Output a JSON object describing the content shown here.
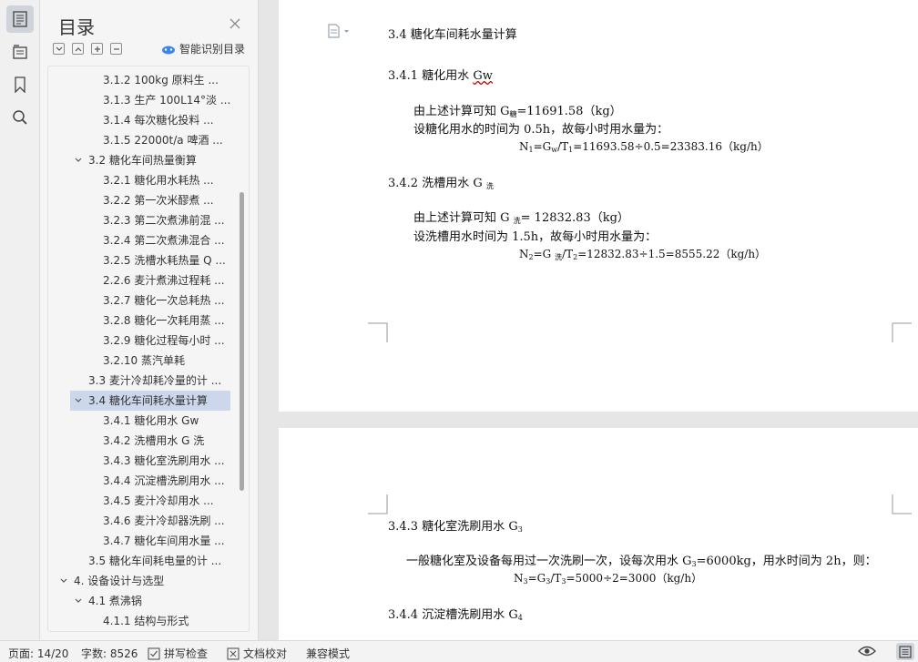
{
  "toc": {
    "title": "目录",
    "smart_label": "智能识别目录",
    "items": [
      {
        "label": "3.1.2   100kg 原料生 ..."
      },
      {
        "label": "3.1.3  生产 100L14°淡 ..."
      },
      {
        "label": "3.1.4   每次糖化投料 ..."
      },
      {
        "label": "3.1.5   22000t/a 啤酒 ..."
      },
      {
        "label": "3.2   糖化车间热量衡算"
      },
      {
        "label": "3.2.1   糖化用水耗热 ..."
      },
      {
        "label": "3.2.2   第一次米醪煮 ..."
      },
      {
        "label": "3.2.3  第二次煮沸前混 ..."
      },
      {
        "label": "3.2.4  第二次煮沸混合 ..."
      },
      {
        "label": "3.2.5  洗槽水耗热量 Q ..."
      },
      {
        "label": "2.2.6 麦汁煮沸过程耗 ..."
      },
      {
        "label": "3.2.7  糖化一次总耗热 ..."
      },
      {
        "label": "3.2.8  糖化一次耗用蒸 ..."
      },
      {
        "label": "3.2.9  糖化过程每小时 ..."
      },
      {
        "label": "3.2.10  蒸汽单耗"
      },
      {
        "label": "3.3  麦汁冷却耗冷量的计 ..."
      },
      {
        "label": "3.4   糖化车间耗水量计算"
      },
      {
        "label": "3.4.1   糖化用水 Gw"
      },
      {
        "label": "3.4.2   洗槽用水 G 洗"
      },
      {
        "label": "3.4.3  糖化室洗刷用水 ..."
      },
      {
        "label": "3.4.4  沉淀槽洗刷用水 ..."
      },
      {
        "label": "3.4.5   麦汁冷却用水 ..."
      },
      {
        "label": "3.4.6  麦汁冷却器洗刷 ..."
      },
      {
        "label": "3.4.7 糖化车间用水量 ..."
      },
      {
        "label": "3.5  糖化车间耗电量的计 ..."
      },
      {
        "label": "4.  设备设计与选型"
      },
      {
        "label": "4.1    煮沸锅"
      },
      {
        "label": "4.1.1    结构与形式"
      }
    ]
  },
  "doc": {
    "h_34": "3.4  糖化车间耗水量计算",
    "h_341_prefix": "3.4.1  糖化用水 ",
    "h_341_suffix": "Gw",
    "p1_a": "由上述计算可知 G",
    "p1_sub": "糖",
    "p1_b": "=11691.58（kg）",
    "p2": "设糖化用水的时间为 0.5h，故每小时用水量为：",
    "f1_a": "N",
    "f1_s1": "1",
    "f1_b": "=G",
    "f1_s2": "w",
    "f1_c": "/T",
    "f1_s3": "1",
    "f1_d": "=11693.58÷0.5=23383.16（kg/h）",
    "h_342_prefix": "3.4.2  洗槽用水 G ",
    "h_342_sub": "洗",
    "p3_a": "由上述计算可知 G ",
    "p3_sub": "洗",
    "p3_b": "= 12832.83（kg）",
    "p4": "设洗槽用水时间为 1.5h，故每小时用水量为：",
    "f2_a": "N",
    "f2_s1": "2",
    "f2_b": "=G ",
    "f2_s2": "洗",
    "f2_c": "/T",
    "f2_s3": "2",
    "f2_d": "=12832.83÷1.5=8555.22（kg/h）",
    "h_343_prefix": "3.4.3 糖化室洗刷用水 G",
    "h_343_sub": "3",
    "p5_a": "一般糖化室及设备每用过一次洗刷一次，设每次用水 G",
    "p5_sub": "3",
    "p5_b": "=6000kg，用水时间为 2h，则：",
    "f3_a": "N",
    "f3_s1": "3",
    "f3_b": "=G",
    "f3_s2": "3",
    "f3_c": "/T",
    "f3_s3": "3",
    "f3_d": "=5000÷2=3000（kg/h）",
    "h_344_prefix": "3.4.4 沉淀槽洗刷用水 G",
    "h_344_sub": "4"
  },
  "status": {
    "page": "页面: 14/20",
    "words": "字数: 8526",
    "spell": "拼写检查",
    "proof": "文档校对",
    "compat": "兼容模式"
  }
}
